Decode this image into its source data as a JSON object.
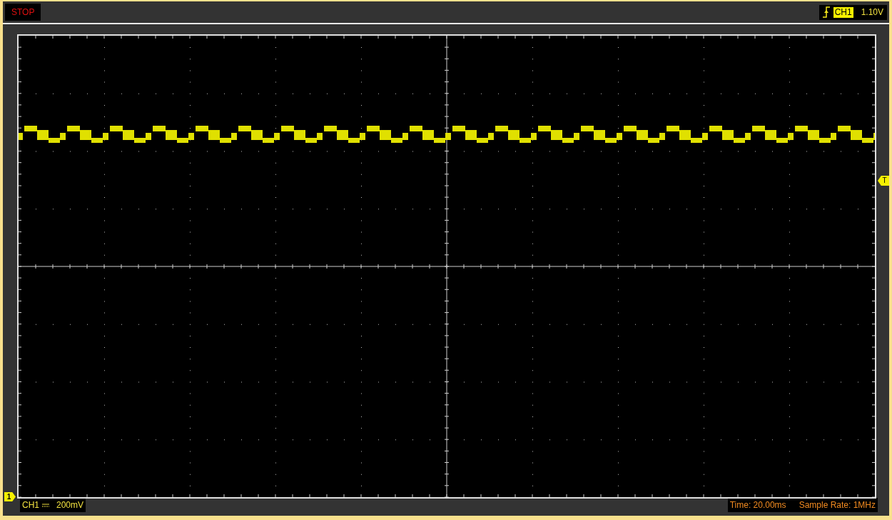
{
  "status": "STOP",
  "trigger": {
    "channel": "CH1",
    "level": "1.10V"
  },
  "markers": {
    "trigger": "T",
    "channel": "1"
  },
  "channel_info": {
    "label": "CH1",
    "scale": "200mV"
  },
  "timebase": "Time: 20.00ms",
  "sample_rate": "Sample Rate: 1MHz"
}
